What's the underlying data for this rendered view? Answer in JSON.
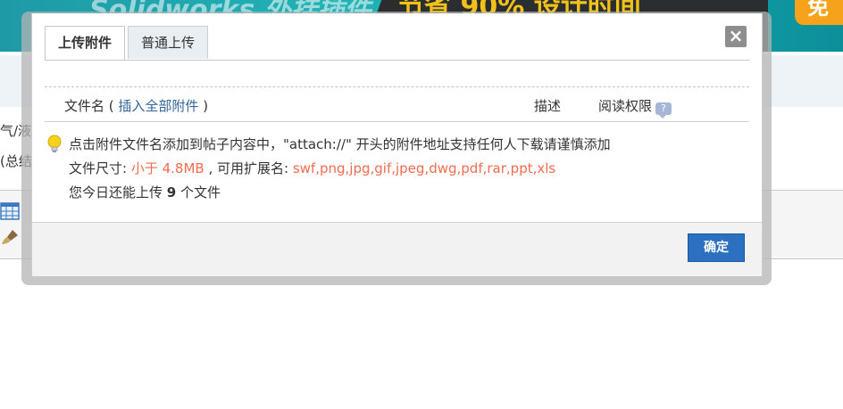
{
  "background": {
    "banner_left_text": "Solidworks 外挂插件",
    "banner_right_text": "节省 90% 设计时间",
    "banner_button": "免",
    "fragment_1": "气/液",
    "fragment_2": "(总结"
  },
  "dialog": {
    "tabs": [
      {
        "label": "上传附件",
        "active": true
      },
      {
        "label": "普通上传",
        "active": false
      }
    ],
    "close_label": "×",
    "header": {
      "filename_label": "文件名 (",
      "insert_all_link": "插入全部附件",
      "filename_close": ")",
      "desc_label": "描述",
      "perm_label": "阅读权限",
      "help_icon_text": "?"
    },
    "tips": {
      "line1": "点击附件文件名添加到帖子内容中，\"attach://\" 开头的附件地址支持任何人下载请谨慎添加",
      "size_label": "文件尺寸: ",
      "size_value": "小于 4.8MB",
      "ext_label": " , 可用扩展名: ",
      "ext_value": "swf,png,jpg,gif,jpeg,dwg,pdf,rar,ppt,xls",
      "today_prefix": "您今日还能上传 ",
      "today_count": "9",
      "today_suffix": " 个文件"
    },
    "ok_label": "确定"
  }
}
